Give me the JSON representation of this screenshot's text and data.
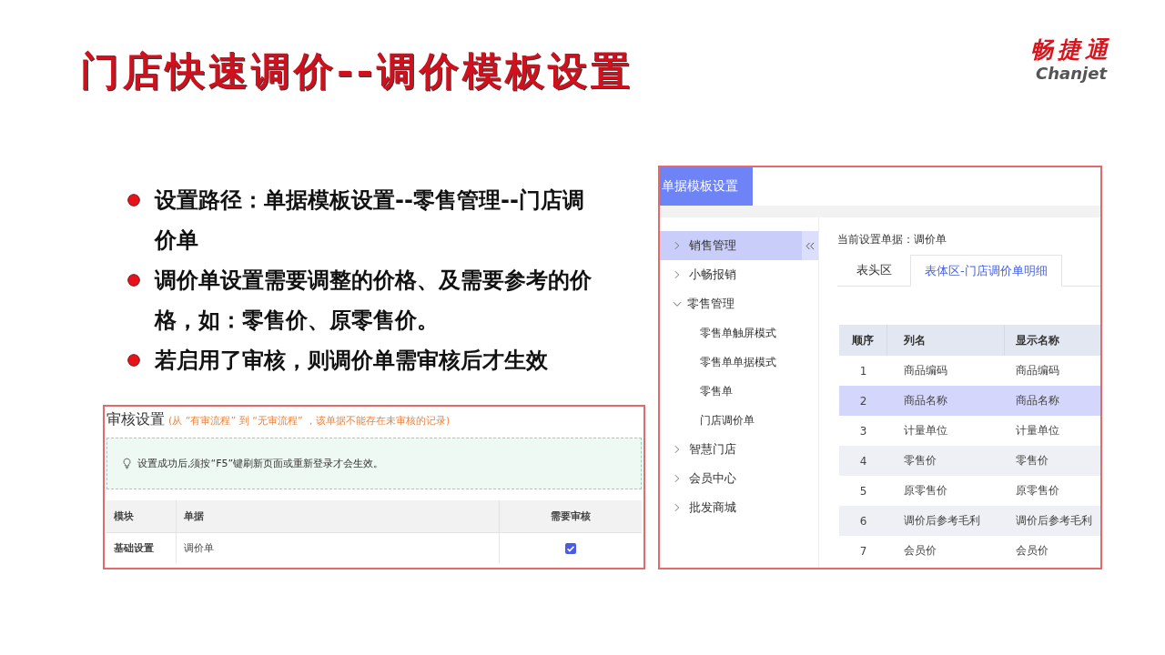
{
  "slide": {
    "title": "门店快速调价--调价模板设置"
  },
  "logo": {
    "text": "畅捷通",
    "subtitle": "Chanjet"
  },
  "bullets": [
    "设置路径：单据模板设置--零售管理--门店调价单",
    "调价单设置需要调整的价格、及需要参考的价格，如：零售价、原零售价。",
    "若启用了审核，则调价单需审核后才生效"
  ],
  "review_panel": {
    "title": "审核设置",
    "note": "(从 “有审流程” 到 “无审流程” ，该单据不能存在未审核的记录)",
    "tip": "设置成功后,须按“F5”键刷新页面或重新登录才会生效。",
    "table": {
      "columns": [
        "模块",
        "单据",
        "需要审核"
      ],
      "rows": [
        {
          "cells": [
            "基础设置",
            "调价单"
          ],
          "checked": true
        }
      ]
    }
  },
  "template_window": {
    "tab": "单据模板设置",
    "sidebar": {
      "items": [
        {
          "label": "销售管理",
          "selected": true,
          "expanded": false
        },
        {
          "label": "小畅报销",
          "selected": false,
          "expanded": false
        },
        {
          "label": "零售管理",
          "selected": false,
          "expanded": true,
          "children": [
            {
              "label": "零售单触屏模式",
              "selected": false
            },
            {
              "label": "零售单单据模式",
              "selected": false
            },
            {
              "label": "零售单",
              "selected": false
            },
            {
              "label": "门店调价单",
              "selected": false
            }
          ]
        },
        {
          "label": "智慧门店",
          "selected": false,
          "expanded": false
        },
        {
          "label": "会员中心",
          "selected": false,
          "expanded": false
        },
        {
          "label": "批发商城",
          "selected": false,
          "expanded": false
        }
      ]
    },
    "current_document": "当前设置单据：调价单",
    "tabs": [
      {
        "label": "表头区",
        "selected": false
      },
      {
        "label": "表体区-门店调价单明细",
        "selected": true
      }
    ],
    "table": {
      "columns": [
        "顺序",
        "列名",
        "显示名称"
      ],
      "rows": [
        {
          "cells": [
            "1",
            "商品编码",
            "商品编码"
          ],
          "selected": false
        },
        {
          "cells": [
            "2",
            "商品名称",
            "商品名称"
          ],
          "selected": true
        },
        {
          "cells": [
            "3",
            "计量单位",
            "计量单位"
          ],
          "selected": false
        },
        {
          "cells": [
            "4",
            "零售价",
            "零售价"
          ],
          "selected": false
        },
        {
          "cells": [
            "5",
            "原零售价",
            "原零售价"
          ],
          "selected": false
        },
        {
          "cells": [
            "6",
            "调价后参考毛利",
            "调价后参考毛利"
          ],
          "selected": false
        },
        {
          "cells": [
            "7",
            "会员价",
            "会员价"
          ],
          "selected": false
        }
      ]
    }
  }
}
